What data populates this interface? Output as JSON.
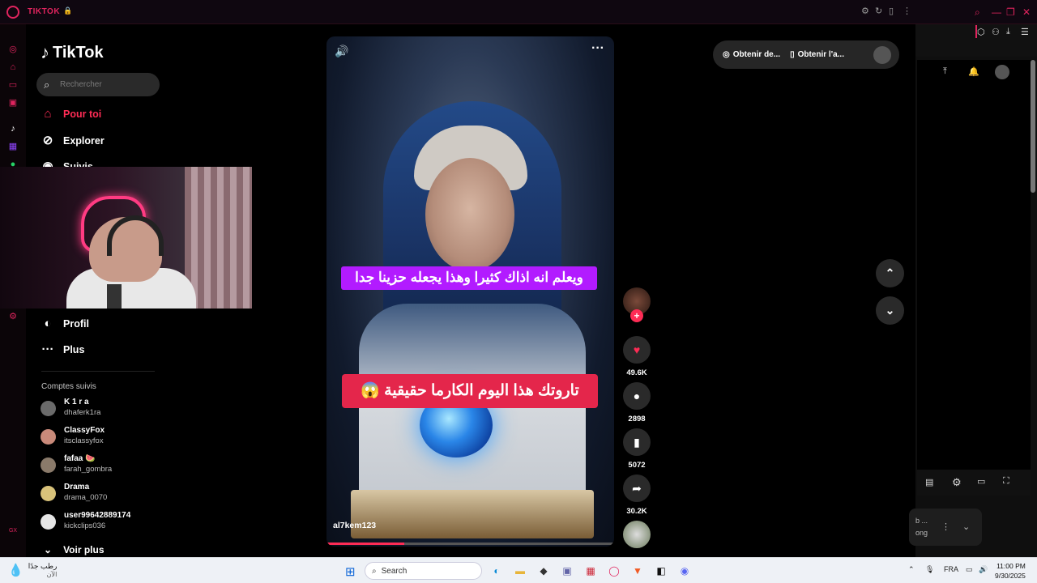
{
  "window": {
    "title": "TIKTOK",
    "lock_icon": "lock-icon"
  },
  "sidebar": {
    "logo": "TikTok",
    "search_placeholder": "Rechercher",
    "nav": [
      {
        "label": "Pour toi",
        "icon": "home-icon",
        "active": true
      },
      {
        "label": "Explorer",
        "icon": "compass-icon",
        "active": false
      },
      {
        "label": "Suivis",
        "icon": "following-icon",
        "active": false
      },
      {
        "label": "Profil",
        "icon": "profile-icon",
        "active": false
      },
      {
        "label": "Plus",
        "icon": "more-dots-icon",
        "active": false
      }
    ],
    "followed_title": "Comptes suivis",
    "accounts": [
      {
        "name": "K 1 r a",
        "username": "dhaferk1ra"
      },
      {
        "name": "ClassyFox",
        "username": "itsclassyfox"
      },
      {
        "name": "fafaa 🍉",
        "username": "farah_gombra"
      },
      {
        "name": "Drama",
        "username": "drama_0070"
      },
      {
        "name": "user99642889174",
        "username": "kickclips036"
      }
    ],
    "see_more": "Voir plus"
  },
  "video": {
    "caption_top": "ويعلم انه اذاك كثيرا وهذا يجعله حزينا جدا",
    "caption_bottom": "تاروتك هذا اليوم الكارما حقيقية 😱",
    "username": "al7kem123",
    "progress": 0.27
  },
  "actions": {
    "likes": "49.6K",
    "comments": "2898",
    "saves": "5072",
    "shares": "30.2K"
  },
  "top_bar": {
    "get_coins": "Obtenir de...",
    "get_app": "Obtenir l'a..."
  },
  "right_panel": {
    "card_line1": "b ...",
    "card_line2": "ong"
  },
  "taskbar": {
    "weather_line1": "رطب جدًا",
    "weather_line2": "الآن",
    "search_label": "Search",
    "language": "FRA",
    "time": "11:00 PM",
    "date": "9/30/2025"
  },
  "colors": {
    "accent": "#fe2c55",
    "caption_purple": "#b21bff",
    "caption_red": "#e4264b"
  }
}
